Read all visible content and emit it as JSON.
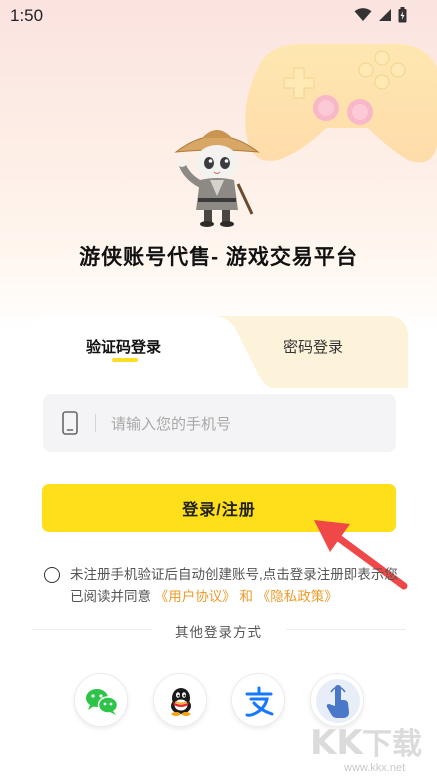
{
  "status_bar": {
    "time": "1:50",
    "icons": [
      "wifi-icon",
      "signal-icon",
      "battery-icon"
    ]
  },
  "app": {
    "title": "游侠账号代售- 游戏交易平台"
  },
  "tabs": [
    {
      "label": "验证码登录",
      "active": true
    },
    {
      "label": "密码登录",
      "active": false
    }
  ],
  "phone_input": {
    "placeholder": "请输入您的手机号",
    "value": ""
  },
  "login_button": {
    "label": "登录/注册"
  },
  "agreement": {
    "checked": false,
    "text_part1": "未注册手机验证后自动创建账号,点击登录注册即表示您已阅读并同意",
    "user_agreement": "《用户协议》",
    "conjunction": "和",
    "privacy_policy": "《隐私政策》"
  },
  "other_login": {
    "title": "其他登录方式",
    "methods": [
      "wechat-icon",
      "qq-icon",
      "alipay-icon",
      "touch-icon"
    ]
  },
  "watermark": {
    "url": "www.kkx.net"
  },
  "colors": {
    "accent": "#ffde1a",
    "link": "#ee9b2a",
    "tab_inactive_bg": "#fdf3da",
    "input_bg": "#f4f4f6",
    "arrow": "#f04848"
  }
}
